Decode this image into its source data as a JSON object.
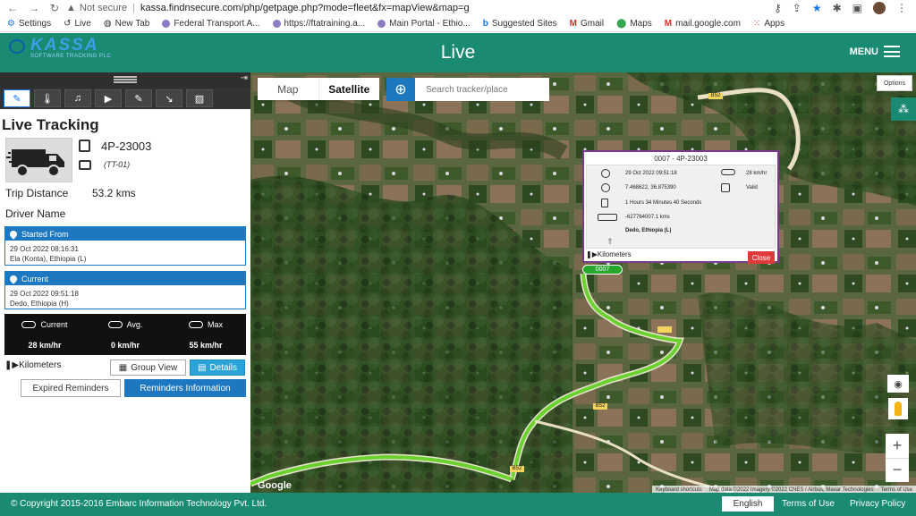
{
  "browser": {
    "secure_label": "Not secure",
    "url": "kassa.findnsecure.com/php/getpage.php?mode=fleet&fx=mapView&map=g",
    "bookmarks": [
      "Settings",
      "Live",
      "New Tab",
      "Federal Transport A...",
      "https://ftatraining.a...",
      "Main Portal - Ethio...",
      "Suggested Sites",
      "Gmail",
      "Maps",
      "mail.google.com",
      "Apps"
    ]
  },
  "header": {
    "logo": "KASSA",
    "logo_sub": "SOFTWARE TRACKING PLC",
    "title": "Live",
    "menu_label": "MENU"
  },
  "sidebar": {
    "title": "Live Tracking",
    "vehicle_plate": "4P-23003",
    "vehicle_code": "(TT-01)",
    "trip_label": "Trip Distance",
    "trip_value": "53.2 kms",
    "driver_label": "Driver Name",
    "started": {
      "label": "Started From",
      "time": "29 Oct 2022 08:16:31",
      "place": "Ela (Konta), Ethiopia (L)"
    },
    "current": {
      "label": "Current",
      "time": "29 Oct 2022 09:51:18",
      "place": "Dedo, Ethiopia (H)"
    },
    "speed": {
      "current_label": "Current",
      "avg_label": "Avg.",
      "max_label": "Max",
      "current_value": "28 km/hr",
      "avg_value": "0 km/hr",
      "max_value": "55 km/hr"
    },
    "km_label": "Kilometers",
    "group_view_label": "Group View",
    "details_label": "Details",
    "expired_label": "Expired Reminders",
    "reminders_label": "Reminders Information"
  },
  "map": {
    "map_label": "Map",
    "satellite_label": "Satellite",
    "search_placeholder": "Search tracker/place",
    "options_label": "Options",
    "google": "Google",
    "attribution": [
      "Keyboard shortcuts",
      "Map data ©2022 Imagery ©2022 CNES / Airbus, Maxar Technologies",
      "Terms of Use"
    ],
    "road_labels": [
      "B52",
      "B52",
      "B52"
    ],
    "marker_label": "0007"
  },
  "info_window": {
    "title": "0007 - 4P-23003",
    "datetime": "29 Oct 2022 09:51:18",
    "speed": "28 km/hr",
    "coords": "7.468622, 36.875390",
    "gps_status": "Valid",
    "duration": "1 Hours 34 Minutes 40 Seconds",
    "odometer": "-627764007.1 kms",
    "location": "Dedo, Ethiopia (L)",
    "km_label": "Kilometers",
    "close_label": "Close"
  },
  "footer": {
    "copyright": "© Copyright 2015-2016 Embarc Information Technology Pvt. Ltd.",
    "language": "English",
    "terms": "Terms of Use",
    "privacy": "Privacy Policy"
  },
  "colors": {
    "header": "#1a8a73",
    "accent_blue": "#1d78c1",
    "close_red": "#e03b3b",
    "route_green": "#6ad12e"
  }
}
